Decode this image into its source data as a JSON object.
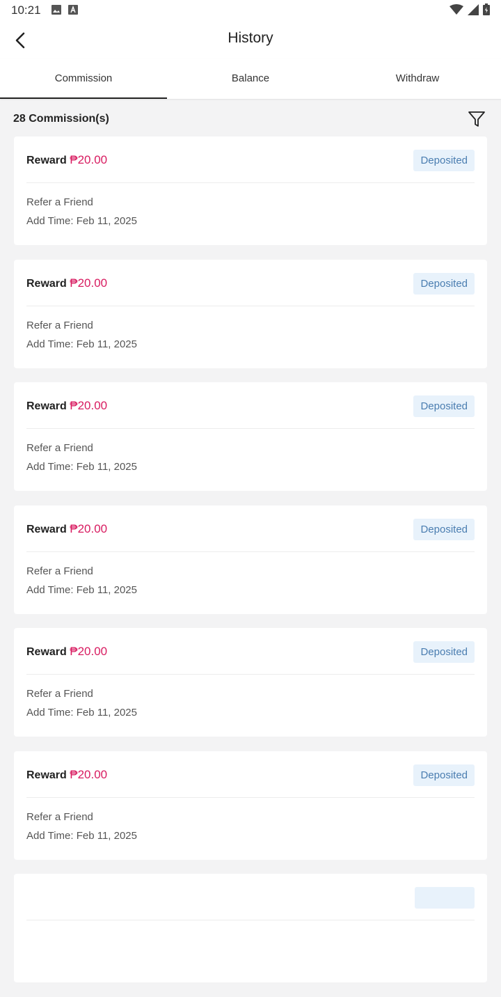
{
  "status_bar": {
    "time": "10:21",
    "left_icons": [
      "image-icon",
      "a-icon"
    ],
    "right_icons": [
      "wifi-icon",
      "signal-icon",
      "battery-icon"
    ]
  },
  "header": {
    "title": "History",
    "back_icon": "back-arrow-icon"
  },
  "tabs": [
    {
      "label": "Commission",
      "active": true
    },
    {
      "label": "Balance",
      "active": false
    },
    {
      "label": "Withdraw",
      "active": false
    }
  ],
  "summary": {
    "count_label": "28 Commission(s)",
    "filter_icon": "filter-icon"
  },
  "colors": {
    "amount": "#d81b60",
    "badge_bg": "#e8f2fb",
    "badge_text": "#4a7db0"
  },
  "records": [
    {
      "label": "Reward",
      "amount": "₱20.00",
      "status": "Deposited",
      "source": "Refer a Friend",
      "time": "Add Time: Feb 11, 2025"
    },
    {
      "label": "Reward",
      "amount": "₱20.00",
      "status": "Deposited",
      "source": "Refer a Friend",
      "time": "Add Time: Feb 11, 2025"
    },
    {
      "label": "Reward",
      "amount": "₱20.00",
      "status": "Deposited",
      "source": "Refer a Friend",
      "time": "Add Time: Feb 11, 2025"
    },
    {
      "label": "Reward",
      "amount": "₱20.00",
      "status": "Deposited",
      "source": "Refer a Friend",
      "time": "Add Time: Feb 11, 2025"
    },
    {
      "label": "Reward",
      "amount": "₱20.00",
      "status": "Deposited",
      "source": "Refer a Friend",
      "time": "Add Time: Feb 11, 2025"
    },
    {
      "label": "Reward",
      "amount": "₱20.00",
      "status": "Deposited",
      "source": "Refer a Friend",
      "time": "Add Time: Feb 11, 2025"
    }
  ]
}
